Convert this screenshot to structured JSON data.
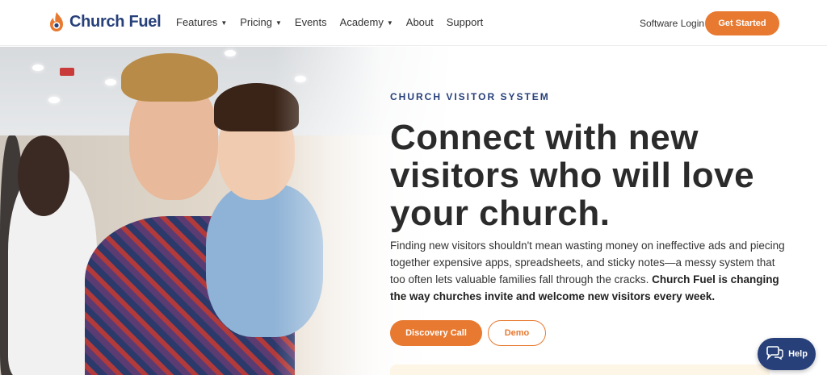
{
  "brand": {
    "name": "Church Fuel",
    "accent": "#e87930",
    "navy": "#27407a"
  },
  "nav": {
    "items": [
      {
        "label": "Features",
        "dropdown": true
      },
      {
        "label": "Pricing",
        "dropdown": true
      },
      {
        "label": "Events",
        "dropdown": false
      },
      {
        "label": "Academy",
        "dropdown": true
      },
      {
        "label": "About",
        "dropdown": false
      },
      {
        "label": "Support",
        "dropdown": false
      }
    ],
    "login_label": "Software Login",
    "cta_label": "Get Started"
  },
  "hero": {
    "eyebrow": "CHURCH VISITOR SYSTEM",
    "headline": "Connect with new visitors who will love your church.",
    "body_plain": "Finding new visitors shouldn't mean wasting money on ineffective ads and piecing together expensive apps, spreadsheets, and sticky notes—a messy system that too often lets valuable families fall through the cracks. ",
    "body_bold": "Church Fuel is changing the way churches invite and welcome new visitors every week.",
    "primary_button": "Discovery Call",
    "secondary_button": "Demo"
  },
  "help": {
    "label": "Help"
  }
}
